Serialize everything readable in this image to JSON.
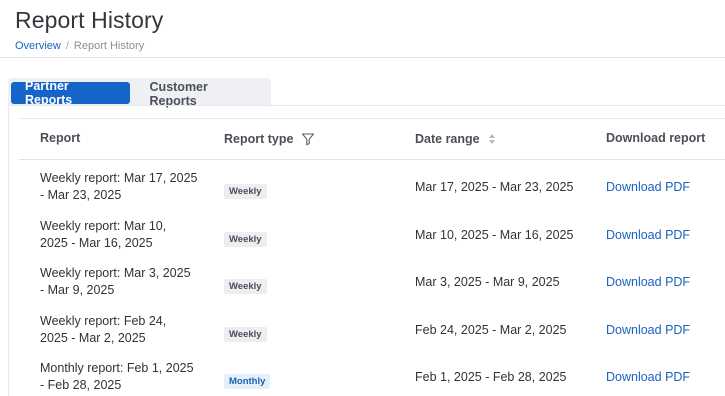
{
  "page": {
    "title": "Report History",
    "breadcrumb": {
      "home": "Overview",
      "separator": "/",
      "current": "Report History"
    }
  },
  "tabs": [
    {
      "label": "Partner Reports",
      "active": true
    },
    {
      "label": "Customer Reports",
      "active": false
    }
  ],
  "table": {
    "columns": {
      "report": "Report",
      "report_type": "Report type",
      "date_range": "Date range",
      "download": "Download report"
    },
    "icons": {
      "report_type": "filter-icon",
      "date_range": "sort-icon"
    },
    "rows": [
      {
        "report_l1": "Weekly report: Mar 17, 2025",
        "report_l2": "- Mar 23, 2025",
        "type": "Weekly",
        "range": "Mar 17, 2025 - Mar 23, 2025",
        "download": "Download PDF"
      },
      {
        "report_l1": "Weekly report: Mar 10,",
        "report_l2": "2025 - Mar 16, 2025",
        "type": "Weekly",
        "range": "Mar 10, 2025 - Mar 16, 2025",
        "download": "Download PDF"
      },
      {
        "report_l1": "Weekly report: Mar 3, 2025",
        "report_l2": "- Mar 9, 2025",
        "type": "Weekly",
        "range": "Mar 3, 2025 - Mar 9, 2025",
        "download": "Download PDF"
      },
      {
        "report_l1": "Weekly report: Feb 24,",
        "report_l2": "2025 - Mar 2, 2025",
        "type": "Weekly",
        "range": "Feb 24, 2025 - Mar 2, 2025",
        "download": "Download PDF"
      },
      {
        "report_l1": "Monthly report: Feb 1, 2025",
        "report_l2": "- Feb 28, 2025",
        "type": "Monthly",
        "range": "Feb 1, 2025 - Feb 28, 2025",
        "download": "Download PDF"
      }
    ]
  },
  "colors": {
    "accent": "#1565c8",
    "link": "#1a62c0",
    "monthly_badge_bg": "#e5f0fb",
    "weekly_badge_bg": "#eceef1"
  }
}
